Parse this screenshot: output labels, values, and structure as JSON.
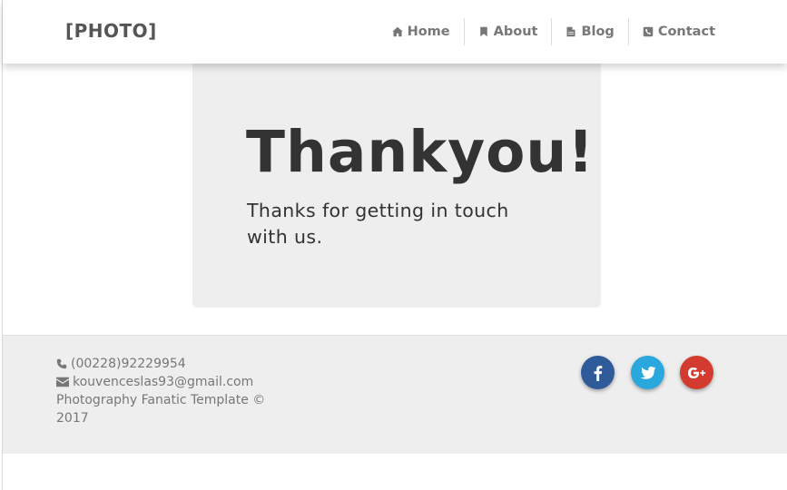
{
  "navbar": {
    "brand": "[PHOTO]",
    "items": [
      {
        "label": "Home",
        "icon": "home-icon"
      },
      {
        "label": "About",
        "icon": "bookmark-icon"
      },
      {
        "label": "Blog",
        "icon": "document-icon"
      },
      {
        "label": "Contact",
        "icon": "phone-square-icon"
      }
    ]
  },
  "hero": {
    "title": "Thankyou!",
    "message": "Thanks for getting in touch with us."
  },
  "footer": {
    "phone": "(00228)92229954",
    "email": "kouvenceslas93@gmail.com",
    "copyright": "Photography Fanatic Template © 2017",
    "social": [
      {
        "name": "facebook",
        "icon": "facebook-icon",
        "color": "#2f5b9b"
      },
      {
        "name": "twitter",
        "icon": "twitter-icon",
        "color": "#2aa7dd"
      },
      {
        "name": "google-plus",
        "icon": "google-plus-icon",
        "color": "#d33b2f"
      }
    ]
  }
}
